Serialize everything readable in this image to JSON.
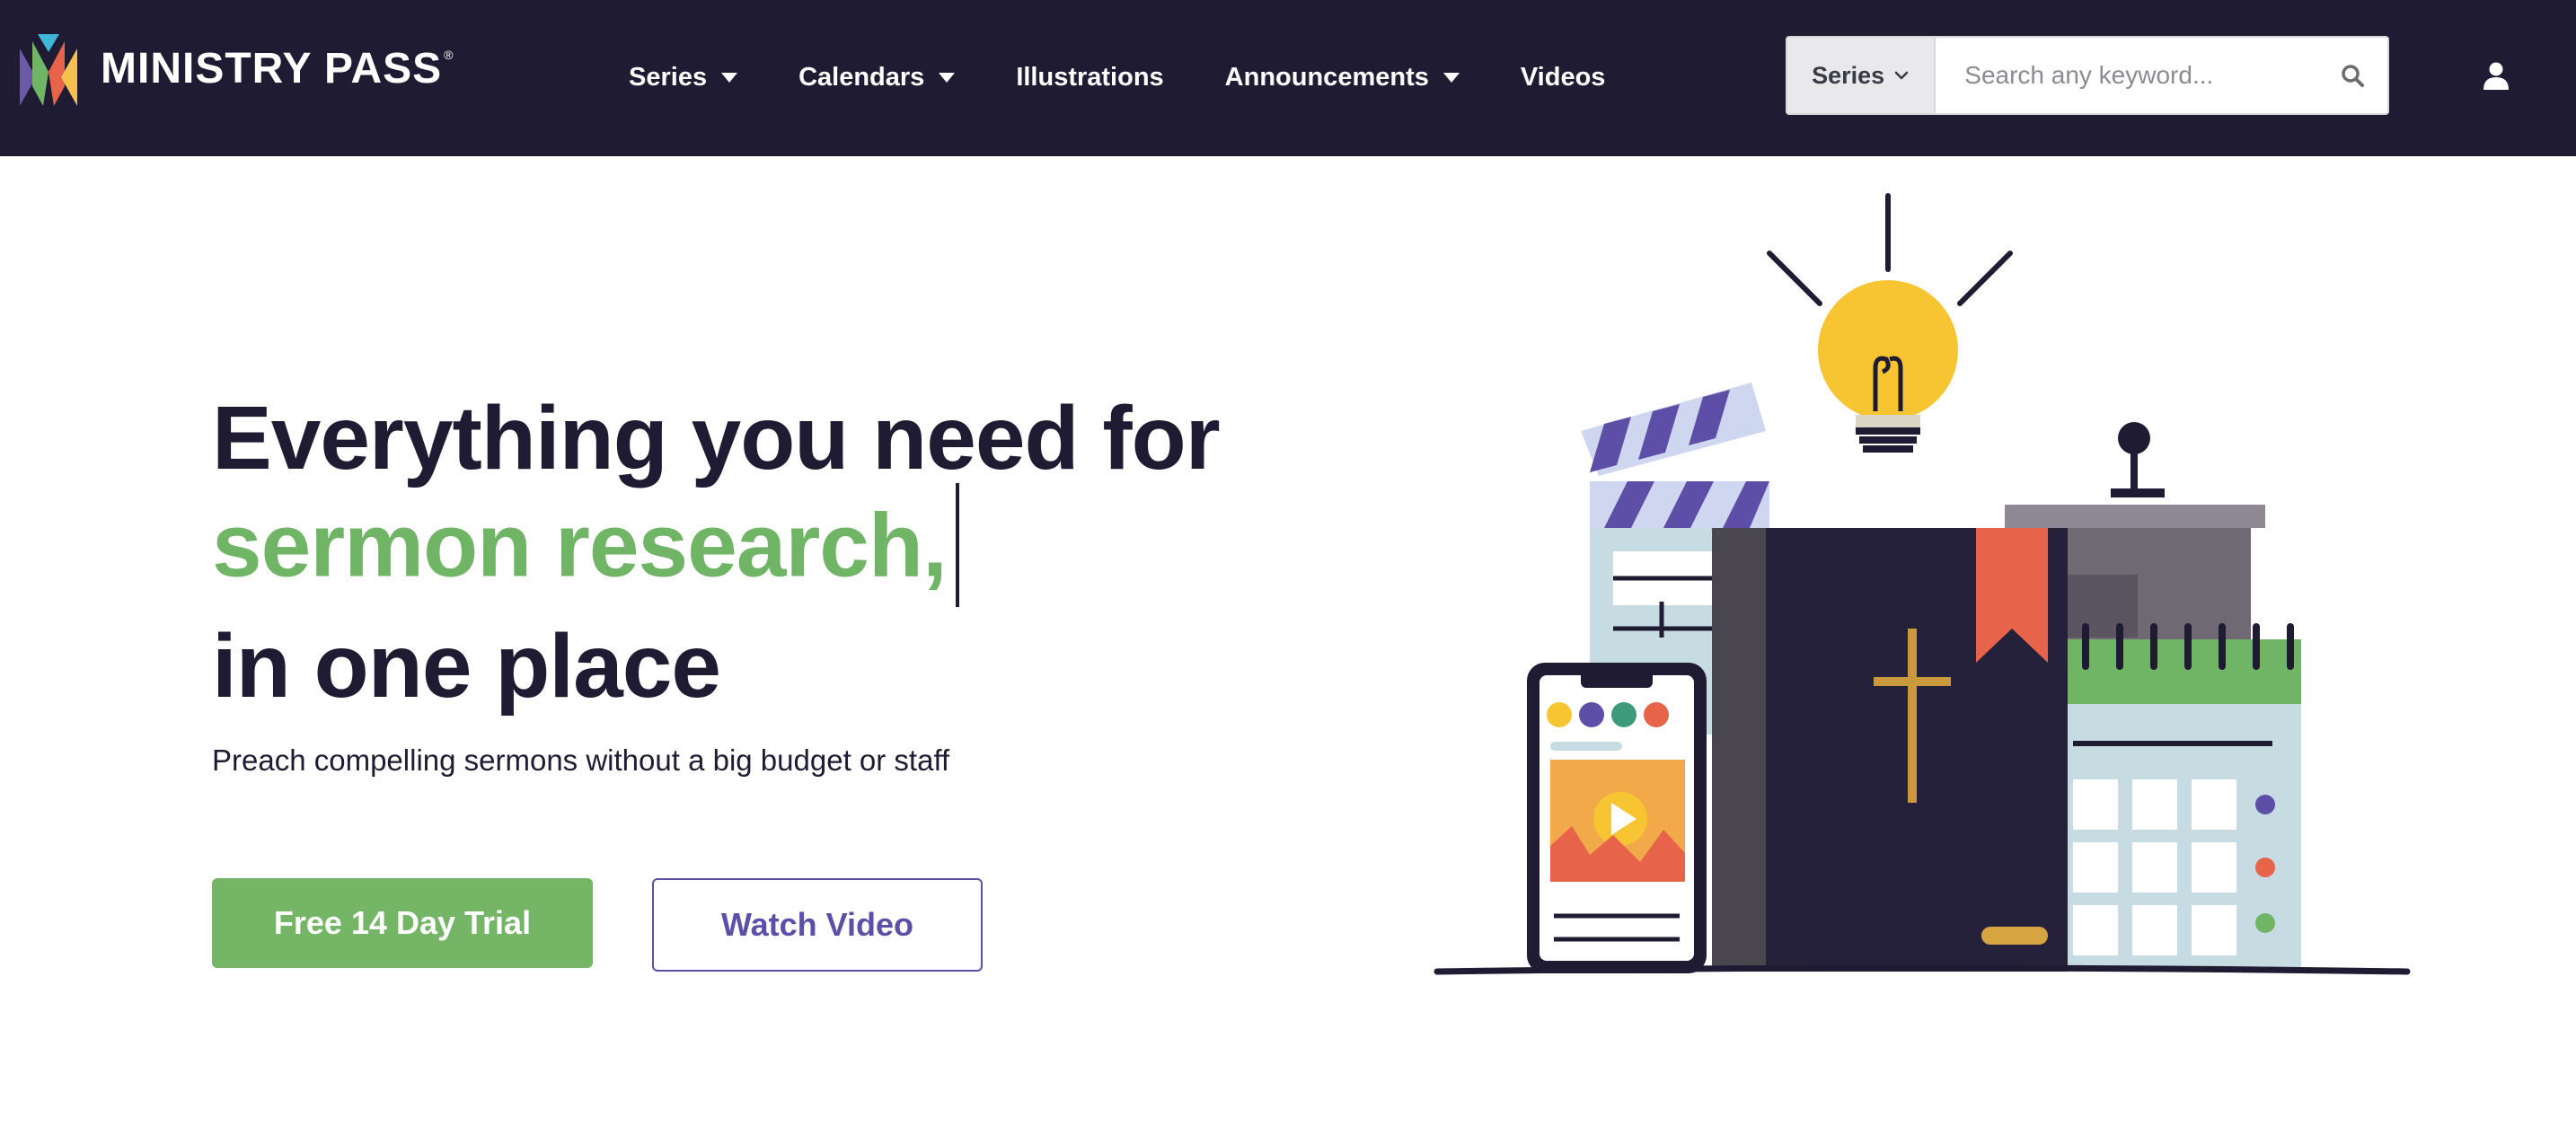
{
  "brand": {
    "name": "MINISTRY PASS",
    "registered_mark": "®"
  },
  "nav": {
    "items": [
      {
        "label": "Series",
        "has_dropdown": true
      },
      {
        "label": "Calendars",
        "has_dropdown": true
      },
      {
        "label": "Illustrations",
        "has_dropdown": false
      },
      {
        "label": "Announcements",
        "has_dropdown": true
      },
      {
        "label": "Videos",
        "has_dropdown": false
      }
    ]
  },
  "search": {
    "scope_selected": "Series",
    "placeholder": "Search any keyword...",
    "value": ""
  },
  "icons": {
    "logo": "ministry-pass-logo",
    "search": "magnifier-icon",
    "user": "user-account-icon",
    "dropdown": "caret-down-icon"
  },
  "hero": {
    "title_line1": "Everything you need for",
    "title_highlight": "sermon research,",
    "title_line3": "in one place",
    "subtitle": "Preach compelling sermons without a big budget or staff",
    "cta_primary": "Free 14 Day Trial",
    "cta_secondary": "Watch Video"
  },
  "colors": {
    "header_bg": "#1f1b33",
    "accent_green": "#74b566",
    "accent_purple": "#5d4fa7",
    "text_dark": "#1f1b33"
  }
}
